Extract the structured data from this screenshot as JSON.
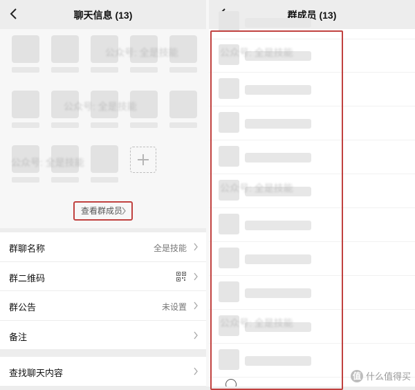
{
  "left": {
    "title": "聊天信息 (13)",
    "watermark": "公众号: 全是技能",
    "view_members_label": "查看群成员",
    "settings": [
      {
        "label": "群聊名称",
        "value": "全是技能"
      },
      {
        "label": "群二维码",
        "value": ""
      },
      {
        "label": "群公告",
        "value": "未设置"
      },
      {
        "label": "备注",
        "value": ""
      }
    ],
    "search_label": "查找聊天内容"
  },
  "right": {
    "title": "群成员 (13)",
    "watermark": "公众号: 全是技能",
    "member_count_rows": 10
  },
  "corner_watermark": {
    "glyph": "值",
    "text": "什么值得买"
  },
  "colors": {
    "highlight": "#c0403e",
    "background": "#ededed",
    "card": "#ffffff"
  },
  "icons": [
    "back-icon",
    "chevron-right-icon",
    "qr-code-icon",
    "plus-icon"
  ]
}
